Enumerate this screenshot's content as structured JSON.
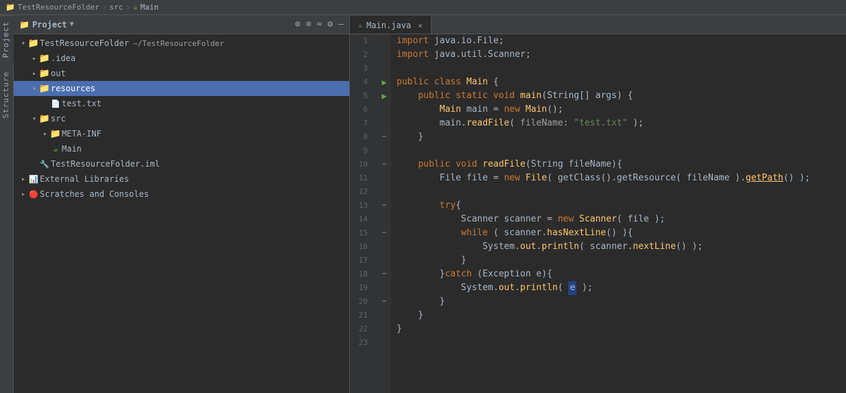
{
  "breadcrumb": {
    "items": [
      "TestResourceFolder",
      "src",
      "Main"
    ],
    "separators": [
      ">",
      ">"
    ]
  },
  "sidebar": {
    "top_labels": [
      "Project",
      "Structure"
    ]
  },
  "project_panel": {
    "title": "Project",
    "arrow": "▼",
    "actions": [
      "⊕",
      "≡",
      "≈",
      "⚙",
      "—"
    ],
    "tree": [
      {
        "id": "root",
        "level": 0,
        "expanded": true,
        "name": "TestResourceFolder",
        "type": "project",
        "extra": "~/TestResourceFolder",
        "selected": false
      },
      {
        "id": "idea",
        "level": 1,
        "expanded": false,
        "name": ".idea",
        "type": "folder-plain",
        "selected": false
      },
      {
        "id": "out",
        "level": 1,
        "expanded": false,
        "name": "out",
        "type": "folder-orange",
        "selected": false
      },
      {
        "id": "resources",
        "level": 1,
        "expanded": true,
        "name": "resources",
        "type": "folder-blue",
        "selected": true
      },
      {
        "id": "test.txt",
        "level": 2,
        "expanded": false,
        "name": "test.txt",
        "type": "file-txt",
        "selected": false
      },
      {
        "id": "src",
        "level": 1,
        "expanded": true,
        "name": "src",
        "type": "folder-plain",
        "selected": false
      },
      {
        "id": "META-INF",
        "level": 2,
        "expanded": false,
        "name": "META-INF",
        "type": "folder-plain",
        "selected": false
      },
      {
        "id": "Main",
        "level": 2,
        "expanded": false,
        "name": "Main",
        "type": "java-file",
        "selected": false
      },
      {
        "id": "TestResourceFolder.iml",
        "level": 1,
        "expanded": false,
        "name": "TestResourceFolder.iml",
        "type": "iml-file",
        "selected": false
      },
      {
        "id": "ext-libs",
        "level": 0,
        "expanded": false,
        "name": "External Libraries",
        "type": "libs",
        "selected": false
      },
      {
        "id": "scratches",
        "level": 0,
        "expanded": false,
        "name": "Scratches and Consoles",
        "type": "scratches",
        "selected": false
      }
    ]
  },
  "editor": {
    "tab_label": "Main.java",
    "tab_icon": "☕",
    "lines": [
      {
        "num": 1,
        "gutter": "",
        "code": "import java.io.File;",
        "tokens": [
          {
            "t": "kw",
            "v": "import"
          },
          {
            "t": "plain",
            "v": " java.io.File;"
          }
        ]
      },
      {
        "num": 2,
        "gutter": "",
        "code": "import java.util.Scanner;",
        "tokens": [
          {
            "t": "kw",
            "v": "import"
          },
          {
            "t": "plain",
            "v": " java.util.Scanner;"
          }
        ]
      },
      {
        "num": 3,
        "gutter": "",
        "code": "",
        "tokens": []
      },
      {
        "num": 4,
        "gutter": "run",
        "code": "public class Main {",
        "tokens": [
          {
            "t": "kw",
            "v": "public"
          },
          {
            "t": "plain",
            "v": " "
          },
          {
            "t": "kw",
            "v": "class"
          },
          {
            "t": "plain",
            "v": " "
          },
          {
            "t": "cls",
            "v": "Main"
          },
          {
            "t": "plain",
            "v": " {"
          }
        ]
      },
      {
        "num": 5,
        "gutter": "run",
        "code": "    public static void main(String[] args) {",
        "tokens": [
          {
            "t": "plain",
            "v": "    "
          },
          {
            "t": "kw",
            "v": "public"
          },
          {
            "t": "plain",
            "v": " "
          },
          {
            "t": "kw",
            "v": "static"
          },
          {
            "t": "plain",
            "v": " "
          },
          {
            "t": "kw",
            "v": "void"
          },
          {
            "t": "plain",
            "v": " "
          },
          {
            "t": "fn",
            "v": "main"
          },
          {
            "t": "plain",
            "v": "("
          },
          {
            "t": "type",
            "v": "String"
          },
          {
            "t": "plain",
            "v": "[] args) {"
          }
        ]
      },
      {
        "num": 6,
        "gutter": "",
        "code": "        Main main = new Main();",
        "tokens": [
          {
            "t": "plain",
            "v": "        "
          },
          {
            "t": "cls",
            "v": "Main"
          },
          {
            "t": "plain",
            "v": " main = "
          },
          {
            "t": "kw",
            "v": "new"
          },
          {
            "t": "plain",
            "v": " "
          },
          {
            "t": "cls",
            "v": "Main"
          },
          {
            "t": "plain",
            "v": "();"
          }
        ]
      },
      {
        "num": 7,
        "gutter": "",
        "code": "        main.readFile( fileName: \"test.txt\" );",
        "tokens": [
          {
            "t": "plain",
            "v": "        main."
          },
          {
            "t": "fn",
            "v": "readFile"
          },
          {
            "t": "plain",
            "v": "( "
          },
          {
            "t": "param",
            "v": "fileName:"
          },
          {
            "t": "plain",
            "v": " "
          },
          {
            "t": "str",
            "v": "\"test.txt\""
          },
          {
            "t": "plain",
            "v": " );"
          }
        ]
      },
      {
        "num": 8,
        "gutter": "fold",
        "code": "    }",
        "tokens": [
          {
            "t": "plain",
            "v": "    }"
          }
        ]
      },
      {
        "num": 9,
        "gutter": "",
        "code": "",
        "tokens": []
      },
      {
        "num": 10,
        "gutter": "fold",
        "code": "    public void readFile(String fileName){",
        "tokens": [
          {
            "t": "plain",
            "v": "    "
          },
          {
            "t": "kw",
            "v": "public"
          },
          {
            "t": "plain",
            "v": " "
          },
          {
            "t": "kw",
            "v": "void"
          },
          {
            "t": "plain",
            "v": " "
          },
          {
            "t": "fn",
            "v": "readFile"
          },
          {
            "t": "plain",
            "v": "("
          },
          {
            "t": "type",
            "v": "String"
          },
          {
            "t": "plain",
            "v": " fileName){"
          }
        ]
      },
      {
        "num": 11,
        "gutter": "",
        "code": "        File file = new File( getClass().getResource( fileName ).getPath() );",
        "tokens": [
          {
            "t": "plain",
            "v": "        "
          },
          {
            "t": "type",
            "v": "File"
          },
          {
            "t": "plain",
            "v": " file = "
          },
          {
            "t": "kw",
            "v": "new"
          },
          {
            "t": "plain",
            "v": " "
          },
          {
            "t": "cls",
            "v": "File"
          },
          {
            "t": "plain",
            "v": "( getClass().getResource( fileName )."
          },
          {
            "t": "method underline",
            "v": "getPath"
          },
          {
            "t": "plain",
            "v": "() );"
          }
        ]
      },
      {
        "num": 12,
        "gutter": "",
        "code": "",
        "tokens": []
      },
      {
        "num": 13,
        "gutter": "fold",
        "code": "        try{",
        "tokens": [
          {
            "t": "plain",
            "v": "        "
          },
          {
            "t": "kw",
            "v": "try"
          },
          {
            "t": "plain",
            "v": "{"
          }
        ]
      },
      {
        "num": 14,
        "gutter": "",
        "code": "            Scanner scanner = new Scanner( file );",
        "tokens": [
          {
            "t": "plain",
            "v": "            "
          },
          {
            "t": "type",
            "v": "Scanner"
          },
          {
            "t": "plain",
            "v": " scanner = "
          },
          {
            "t": "kw",
            "v": "new"
          },
          {
            "t": "plain",
            "v": " "
          },
          {
            "t": "cls",
            "v": "Scanner"
          },
          {
            "t": "plain",
            "v": "( file );"
          }
        ]
      },
      {
        "num": 15,
        "gutter": "fold",
        "code": "            while ( scanner.hasNextLine() ){",
        "tokens": [
          {
            "t": "plain",
            "v": "            "
          },
          {
            "t": "kw",
            "v": "while"
          },
          {
            "t": "plain",
            "v": " ( scanner."
          },
          {
            "t": "fn",
            "v": "hasNextLine"
          },
          {
            "t": "plain",
            "v": "() ){"
          }
        ]
      },
      {
        "num": 16,
        "gutter": "",
        "code": "                System.out.println( scanner.nextLine() );",
        "tokens": [
          {
            "t": "plain",
            "v": "                "
          },
          {
            "t": "type",
            "v": "System"
          },
          {
            "t": "plain",
            "v": "."
          },
          {
            "t": "fn",
            "v": "out"
          },
          {
            "t": "plain",
            "v": "."
          },
          {
            "t": "fn",
            "v": "println"
          },
          {
            "t": "plain",
            "v": "( scanner."
          },
          {
            "t": "fn",
            "v": "nextLine"
          },
          {
            "t": "plain",
            "v": "() );"
          }
        ]
      },
      {
        "num": 17,
        "gutter": "",
        "code": "            }",
        "tokens": [
          {
            "t": "plain",
            "v": "            }"
          }
        ]
      },
      {
        "num": 18,
        "gutter": "fold",
        "code": "        }catch (Exception e){",
        "tokens": [
          {
            "t": "plain",
            "v": "        }"
          },
          {
            "t": "kw",
            "v": "catch"
          },
          {
            "t": "plain",
            "v": " ("
          },
          {
            "t": "type",
            "v": "Exception"
          },
          {
            "t": "plain",
            "v": " e){"
          }
        ]
      },
      {
        "num": 19,
        "gutter": "",
        "code": "            System.out.println( e );",
        "tokens": [
          {
            "t": "plain",
            "v": "            "
          },
          {
            "t": "type",
            "v": "System"
          },
          {
            "t": "plain",
            "v": "."
          },
          {
            "t": "fn",
            "v": "out"
          },
          {
            "t": "plain",
            "v": "."
          },
          {
            "t": "fn",
            "v": "println"
          },
          {
            "t": "plain",
            "v": "( "
          },
          {
            "t": "highlight-bg plain",
            "v": "e"
          },
          {
            "t": "plain",
            "v": " );"
          }
        ]
      },
      {
        "num": 20,
        "gutter": "fold",
        "code": "        }",
        "tokens": [
          {
            "t": "plain",
            "v": "        }"
          }
        ]
      },
      {
        "num": 21,
        "gutter": "",
        "code": "    }",
        "tokens": [
          {
            "t": "plain",
            "v": "    }"
          }
        ]
      },
      {
        "num": 22,
        "gutter": "",
        "code": "}",
        "tokens": [
          {
            "t": "plain",
            "v": "}"
          }
        ]
      },
      {
        "num": 23,
        "gutter": "",
        "code": "",
        "tokens": []
      }
    ]
  }
}
